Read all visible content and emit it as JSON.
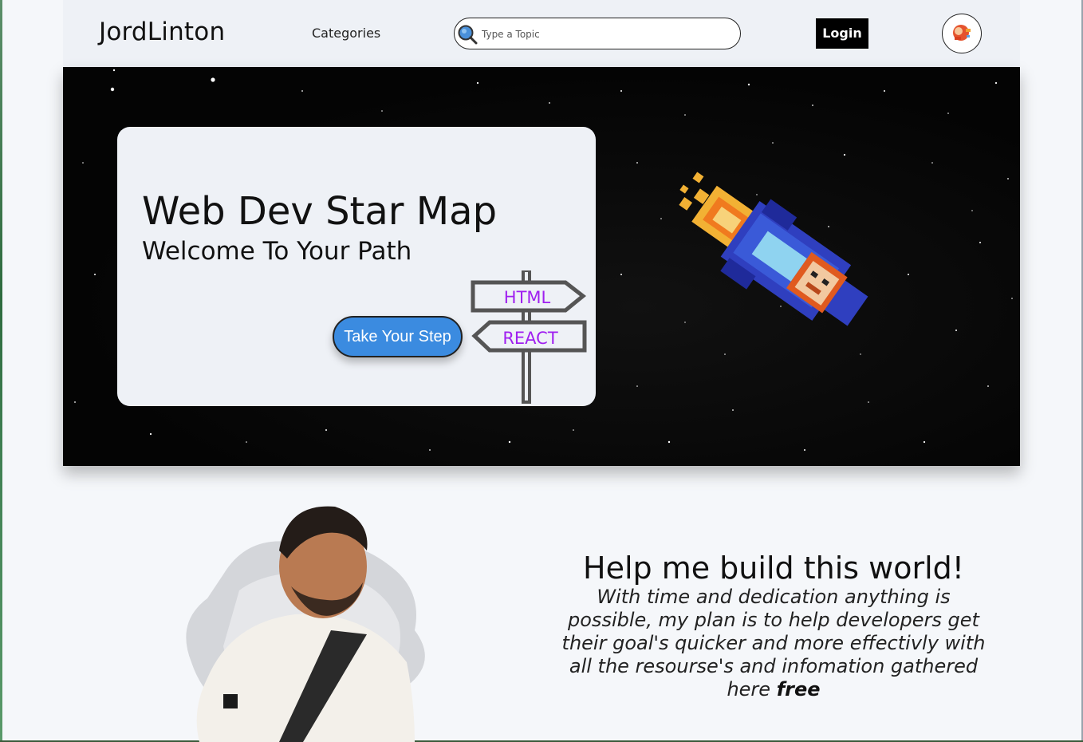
{
  "nav": {
    "logo": "JordLinton",
    "categories_label": "Categories",
    "search_placeholder": "Type a Topic",
    "login_label": "Login"
  },
  "hero": {
    "title": "Web Dev Star Map",
    "subtitle": "Welcome To Your Path",
    "cta_label": "Take Your Step",
    "sign_top": "HTML",
    "sign_bottom": "REACT"
  },
  "help": {
    "title": "Help me build this world!",
    "text": "With time and dedication anything is possible, my plan is to help developers get their goal's quicker and more effectivly with all the resourse's and infomation gathered here",
    "text_emphasis": "free"
  },
  "colors": {
    "accent": "#3b8be0",
    "sign_text": "#a020f0"
  }
}
